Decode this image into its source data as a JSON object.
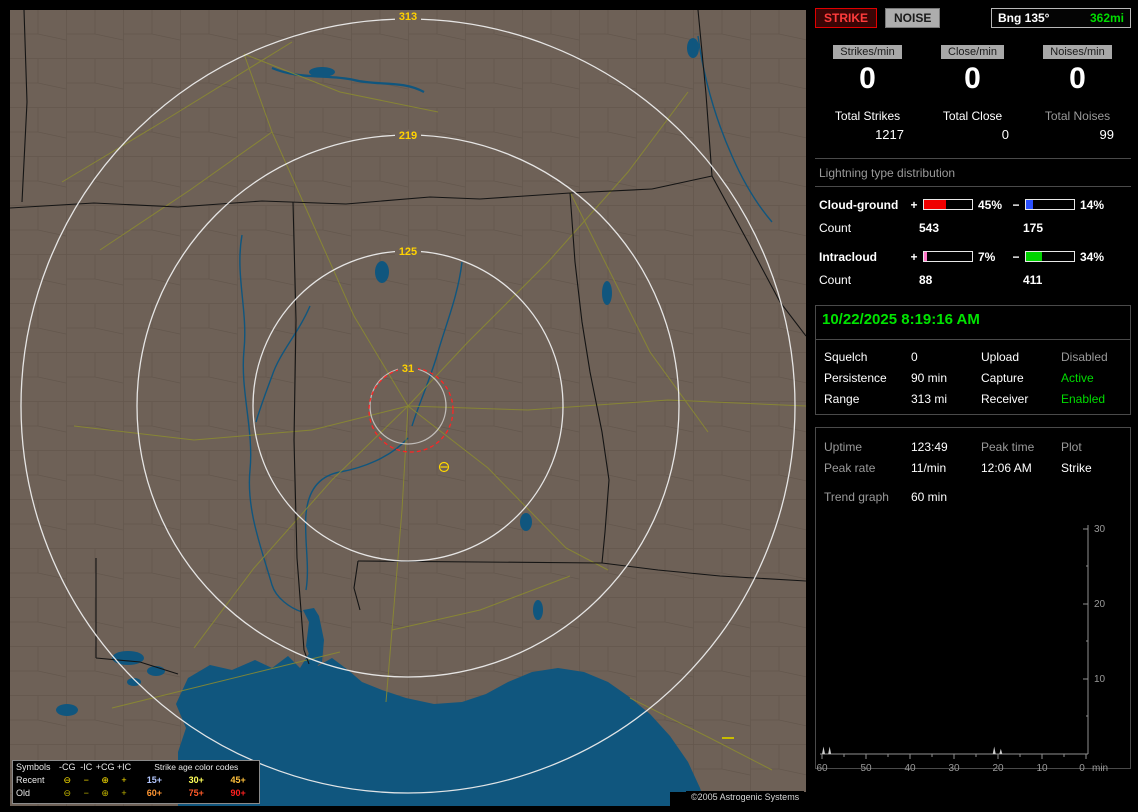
{
  "map": {
    "ring_labels": [
      "313",
      "219",
      "125",
      "31"
    ],
    "copyright": "©2005 Astrogenic Systems",
    "legend": {
      "header_symbols": "Symbols",
      "columns": [
        "-CG",
        "-IC",
        "+CG",
        "+IC"
      ],
      "age_title": "Strike age color codes",
      "rows": [
        {
          "label": "Recent",
          "symbols": [
            "⊖",
            "−",
            "⊕",
            "+"
          ],
          "symbol_color": "#ffe400",
          "ages": [
            {
              "t": "15+",
              "c": "#b4c8ff"
            },
            {
              "t": "30+",
              "c": "#ffff5a"
            },
            {
              "t": "45+",
              "c": "#ffc03c"
            }
          ]
        },
        {
          "label": "Old",
          "symbols": [
            "⊖",
            "−",
            "⊕",
            "+"
          ],
          "symbol_color": "#c2b600",
          "ages": [
            {
              "t": "60+",
              "c": "#ff9632"
            },
            {
              "t": "75+",
              "c": "#ff5a28"
            },
            {
              "t": "90+",
              "c": "#ff2020"
            }
          ]
        }
      ]
    }
  },
  "panel": {
    "strike_button": "STRIKE",
    "noise_button": "NOISE",
    "bearing_label": "Bng 135°",
    "bearing_value": "362mi",
    "rates": [
      {
        "label": "Strikes/min",
        "value": "0",
        "total_label": "Total Strikes",
        "total_value": "1217"
      },
      {
        "label": "Close/min",
        "value": "0",
        "total_label": "Total Close",
        "total_value": "0"
      },
      {
        "label": "Noises/min",
        "value": "0",
        "total_label": "Total Noises",
        "total_value": "99"
      }
    ],
    "distribution": {
      "title": "Lightning type distribution",
      "plus_sign": "+",
      "minus_sign": "−",
      "count_label": "Count",
      "rows": [
        {
          "label": "Cloud-ground",
          "plus_pct": "45%",
          "plus_fill": 45,
          "plus_color": "#f00000",
          "minus_pct": "14%",
          "minus_fill": 14,
          "minus_color": "#2a50ff",
          "plus_count": "543",
          "minus_count": "175"
        },
        {
          "label": "Intracloud",
          "plus_pct": "7%",
          "plus_fill": 7,
          "plus_color": "#ff78c8",
          "minus_pct": "34%",
          "minus_fill": 34,
          "minus_color": "#00d200",
          "plus_count": "88",
          "minus_count": "411"
        }
      ]
    },
    "status": {
      "datetime": "10/22/2025 8:19:16 AM",
      "rows": [
        {
          "k1": "Squelch",
          "v1": "0",
          "k2": "Upload",
          "v2": "Disabled",
          "v2_color": "#9a9a9a"
        },
        {
          "k1": "Persistence",
          "v1": "90 min",
          "k2": "Capture",
          "v2": "Active",
          "v2_color": "#00dc00"
        },
        {
          "k1": "Range",
          "v1": "313 mi",
          "k2": "Receiver",
          "v2": "Enabled",
          "v2_color": "#00dc00"
        }
      ]
    },
    "stats": {
      "uptime_label": "Uptime",
      "uptime_value": "123:49",
      "peak_time_label": "Peak time",
      "plot_label": "Plot",
      "peak_rate_label": "Peak rate",
      "peak_rate_value": "11/min",
      "peak_time_value": "12:06 AM",
      "plot_value": "Strike",
      "trend_label": "Trend graph",
      "trend_value": "60 min"
    }
  },
  "trend_chart": {
    "type": "line",
    "x_ticks": [
      "60",
      "50",
      "40",
      "30",
      "20",
      "10",
      "0"
    ],
    "x_unit": "min",
    "y_ticks": [
      "30",
      "20",
      "10"
    ],
    "y_max": 30,
    "spikes": [
      {
        "min_ago": 60,
        "rate": 1
      },
      {
        "min_ago": 58.6,
        "rate": 1
      },
      {
        "min_ago": 21.2,
        "rate": 1
      },
      {
        "min_ago": 19.7,
        "rate": 0.7
      }
    ]
  }
}
